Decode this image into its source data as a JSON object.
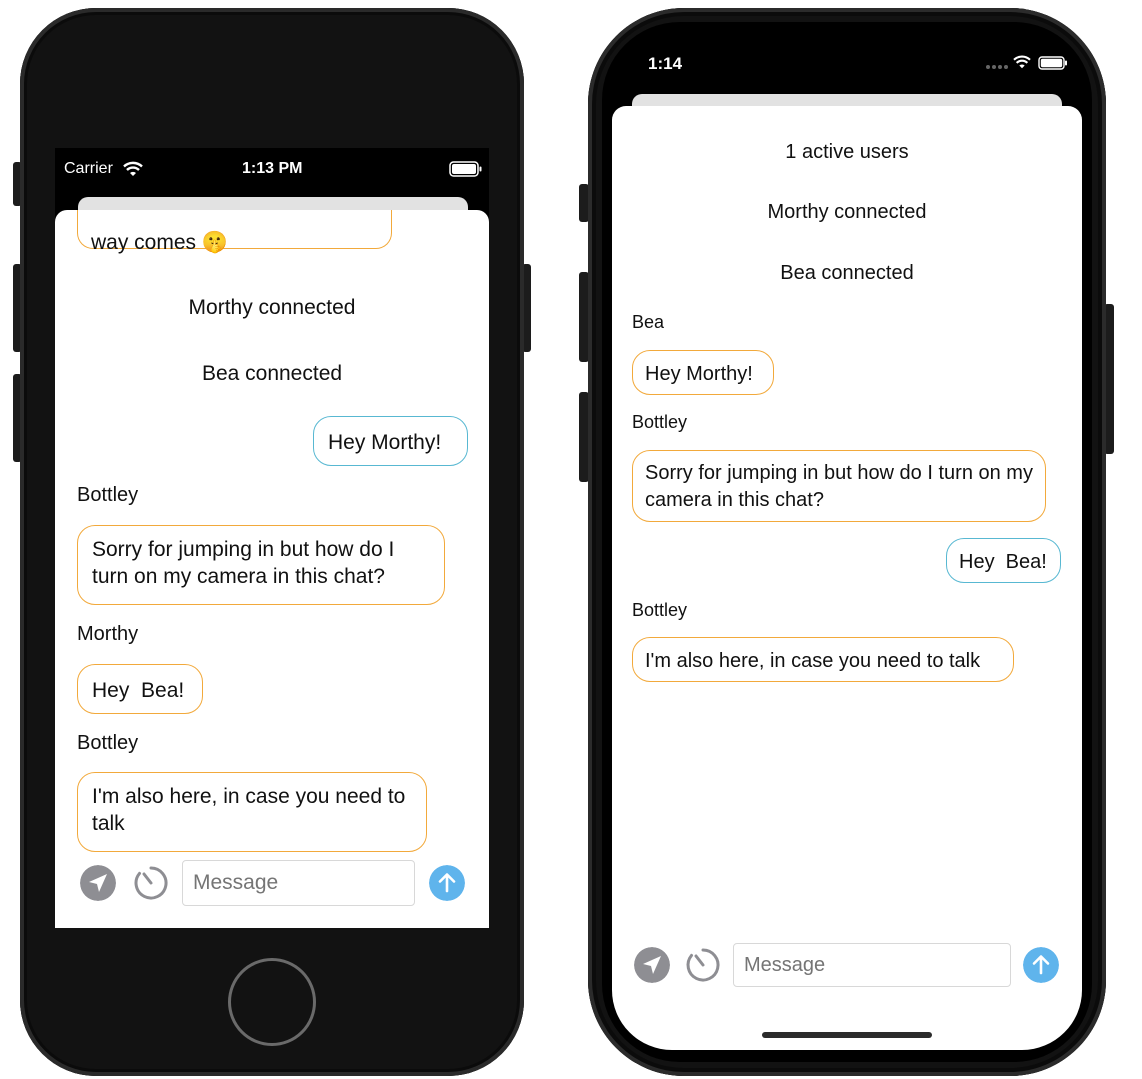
{
  "left_phone": {
    "status_bar": {
      "carrier": "Carrier",
      "time": "1:13 PM"
    },
    "messages": {
      "partial_text": "way comes",
      "partial_emoji": "🤫",
      "system_1": "Morthy connected",
      "system_2": "Bea connected",
      "outgoing_1": "Hey Morthy!",
      "sender_1": "Bottley",
      "incoming_1": "Sorry for jumping in but how do I turn on my camera in this chat?",
      "sender_2": "Morthy",
      "incoming_2": "Hey  Bea!",
      "sender_3": "Bottley",
      "incoming_3": "I'm also here, in case you need to talk"
    },
    "composer": {
      "placeholder": "Message"
    }
  },
  "right_phone": {
    "status_bar": {
      "time": "1:14"
    },
    "messages": {
      "system_1": "1 active users",
      "system_2": "Morthy connected",
      "system_3": "Bea connected",
      "sender_1": "Bea",
      "incoming_1": "Hey Morthy!",
      "sender_2": "Bottley",
      "incoming_2": "Sorry for jumping in but how do I turn on my camera in this chat?",
      "outgoing_1": "Hey  Bea!",
      "sender_3": "Bottley",
      "incoming_3": "I'm also here, in case you need to talk"
    },
    "composer": {
      "placeholder": "Message"
    }
  },
  "icons": {
    "location": "location-arrow-icon",
    "timer": "timer-icon",
    "send": "send-arrow-up-icon",
    "wifi": "wifi-icon",
    "battery": "battery-icon"
  },
  "colors": {
    "incoming_border": "#f2a93b",
    "outgoing_border": "#58b8d2",
    "send_button": "#5fb4ec",
    "icon_gray": "#8e8e93"
  }
}
